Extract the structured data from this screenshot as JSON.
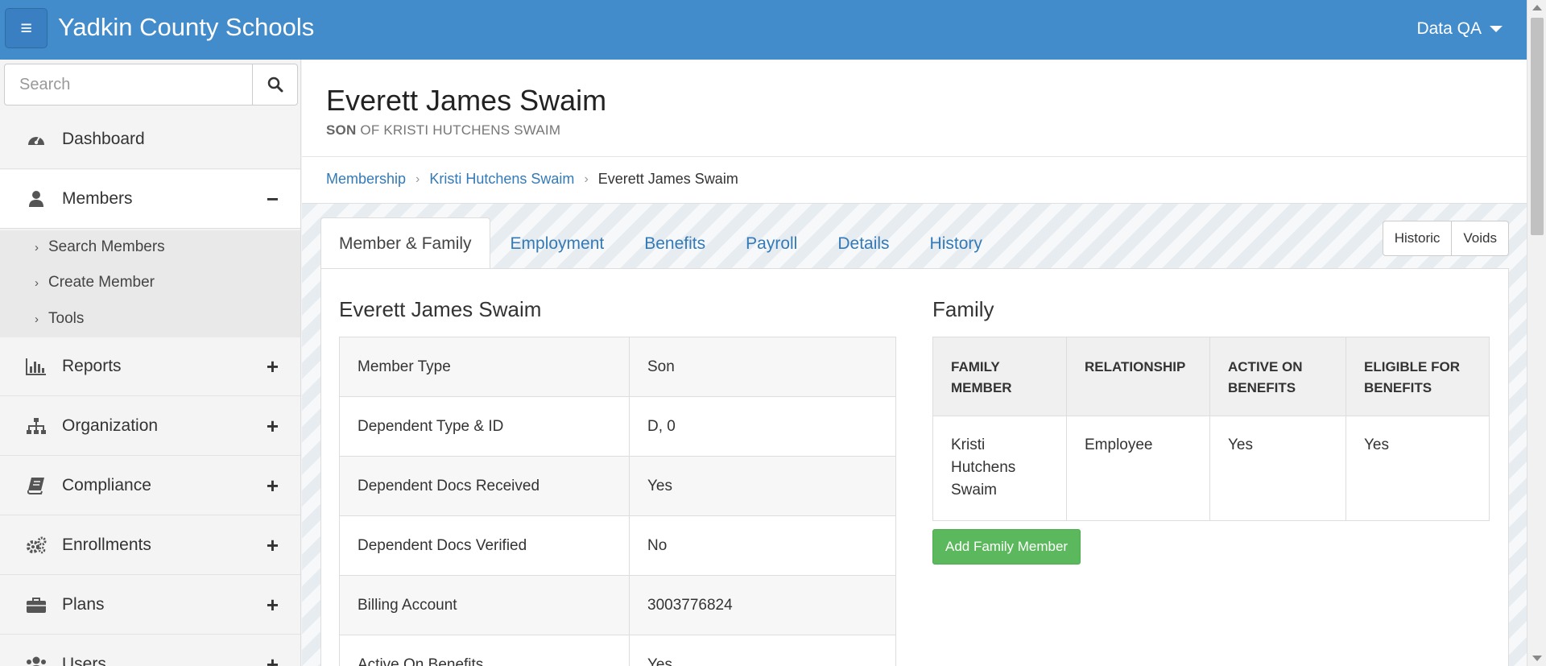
{
  "app": {
    "brand": "Yadkin County Schools",
    "user_menu": "Data QA"
  },
  "sidebar": {
    "search_placeholder": "Search",
    "items": [
      {
        "label": "Dashboard",
        "icon": "dashboard-icon",
        "toggle": ""
      },
      {
        "label": "Members",
        "icon": "user-icon",
        "toggle": "−"
      },
      {
        "label": "Reports",
        "icon": "bar-chart-icon",
        "toggle": "+"
      },
      {
        "label": "Organization",
        "icon": "sitemap-icon",
        "toggle": "+"
      },
      {
        "label": "Compliance",
        "icon": "book-icon",
        "toggle": "+"
      },
      {
        "label": "Enrollments",
        "icon": "gears-icon",
        "toggle": "+"
      },
      {
        "label": "Plans",
        "icon": "briefcase-icon",
        "toggle": "+"
      },
      {
        "label": "Users",
        "icon": "users-icon",
        "toggle": "+"
      }
    ],
    "members_sub": [
      "Search Members",
      "Create Member",
      "Tools"
    ]
  },
  "page": {
    "title": "Everett James Swaim",
    "subtitle_bold": "SON",
    "subtitle_rest": "OF KRISTI HUTCHENS SWAIM"
  },
  "breadcrumb": [
    "Membership",
    "Kristi Hutchens Swaim",
    "Everett James Swaim"
  ],
  "tabs": [
    "Member & Family",
    "Employment",
    "Benefits",
    "Payroll",
    "Details",
    "History"
  ],
  "actions": {
    "historic": "Historic",
    "voids": "Voids"
  },
  "member": {
    "title": "Everett James Swaim",
    "rows": [
      {
        "key": "Member Type",
        "value": "Son"
      },
      {
        "key": "Dependent Type & ID",
        "value": "D, 0"
      },
      {
        "key": "Dependent Docs Received",
        "value": "Yes"
      },
      {
        "key": "Dependent Docs Verified",
        "value": "No"
      },
      {
        "key": "Billing Account",
        "value": "3003776824"
      },
      {
        "key": "Active On Benefits",
        "value": "Yes"
      }
    ]
  },
  "family": {
    "title": "Family",
    "headers": [
      "FAMILY MEMBER",
      "RELATIONSHIP",
      "ACTIVE ON BENEFITS",
      "ELIGIBLE FOR BENEFITS"
    ],
    "rows": [
      [
        "Kristi Hutchens Swaim",
        "Employee",
        "Yes",
        "Yes"
      ]
    ],
    "add_button": "Add Family Member"
  },
  "colors": {
    "topbar": "#438ccb",
    "link": "#337ab7",
    "success": "#5cb85c"
  }
}
